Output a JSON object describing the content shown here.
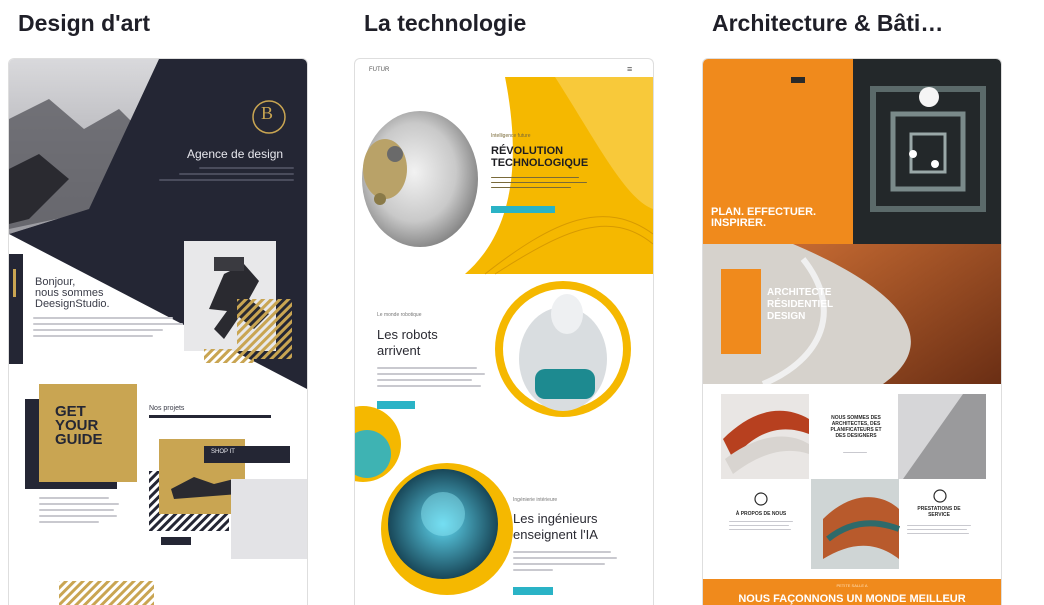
{
  "columns": [
    {
      "title": "Design d'art",
      "card": {
        "logo_letter": "B",
        "agency_title": "Agence de design",
        "hello_text": "Bonjour,\nnous sommes\nDeesignStudio.",
        "guide_text": "GET\nYOUR\nGUIDE",
        "projects_label": "Nos projets",
        "shop_label": "SHOP IT",
        "small_btn": "—"
      }
    },
    {
      "title": "La technologie",
      "card": {
        "nav_brand": "FUTUR",
        "nav_menu": "≡",
        "hero_kicker": "Intelligence future",
        "hero_title": "RÉVOLUTION\nTECHNOLOGIQUE",
        "robots_kicker": "Le monde robotique",
        "robots_title": "Les robots\narrivent",
        "engineers_kicker": "Ingénierie intérieure",
        "engineers_title": "Les ingénieurs\nenseignent l'IA"
      }
    },
    {
      "title": "Architecture & Bâti…",
      "card": {
        "hero_text": "PLAN. EFFECTUER.\nINSPIRER.",
        "architect_text": "ARCHITECTE\nRÉSIDENTIEL\nDESIGN",
        "about_heading": "NOUS SOMMES DES\nARCHITECTES, DES\nPLANIFICATEURS ET\nDES DESIGNERS",
        "about_label": "À PROPOS DE NOUS",
        "services_label": "PRESTATIONS DE\nSERVICE",
        "footer_kicker": "PETITE SALLE A",
        "footer_text": "NOUS FAÇONNONS UN MONDE MEILLEUR"
      }
    }
  ],
  "colors": {
    "dark_navy": "#242634",
    "gold": "#c9a552",
    "tech_yellow": "#f5b800",
    "tech_teal": "#2ab3c6",
    "arch_orange": "#f08a1c"
  }
}
